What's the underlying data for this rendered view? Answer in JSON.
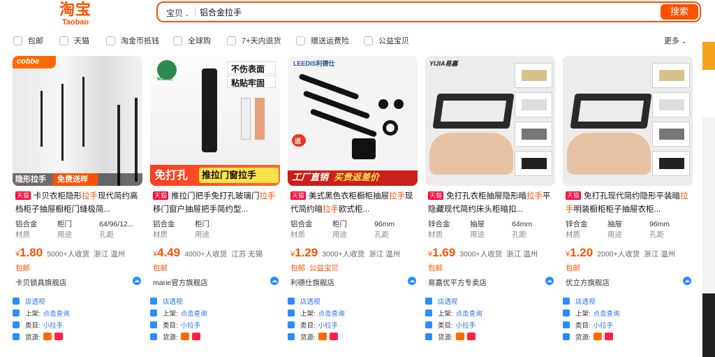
{
  "header": {
    "logo_cn": "淘宝",
    "logo_en": "Taobao",
    "scope": "宝贝",
    "query": "铝合金拉手",
    "search_button": "搜索"
  },
  "filters": {
    "items": [
      "包邮",
      "天猫",
      "淘金币抵钱",
      "全球购",
      "7+天内退货",
      "赠送运费险",
      "公益宝贝"
    ],
    "more": "更多"
  },
  "accent_color": "#ff5000",
  "products": [
    {
      "badge": "天猫",
      "title_pre": "卡贝衣柜隐形",
      "title_hl": "拉手",
      "title_post": "现代简约高档柜子抽屉橱柜门缝极简...",
      "attrs": [
        [
          "铝合金",
          "材质"
        ],
        [
          "柜门",
          "用途"
        ],
        [
          "64/96/12...",
          "孔距"
        ]
      ],
      "price": "1.80",
      "sold": "5000+人收货",
      "location": "浙江 温州",
      "tags": [
        "包邮"
      ],
      "shop": "卡贝锁具旗舰店",
      "img_brand": "cobbe",
      "img_tags": [
        "隐形拉手",
        "免费送样"
      ]
    },
    {
      "badge": "天猫",
      "title_pre": "推拉门把手免打孔玻璃门",
      "title_hl": "拉手",
      "title_post": "移门窗户抽屉把手简约型...",
      "attrs": [
        [
          "铝合金",
          "材质"
        ],
        [
          "柜门",
          "用途"
        ],
        [
          "",
          ""
        ]
      ],
      "price": "4.49",
      "sold": "4000+人收货",
      "location": "江苏 无锡",
      "tags": [
        "包邮"
      ],
      "shop": "marie官方旗舰店",
      "img_brand": "MARIE",
      "img_tags": [
        "不伤表面",
        "粘贴牢固",
        "免打孔",
        "推拉门窗拉手"
      ]
    },
    {
      "badge": "天猫",
      "title_pre": "美式黑色衣柜橱柜抽屉",
      "title_hl": "拉手",
      "title_mid": "现代简约暗",
      "title_hl2": "拉手",
      "title_post": "欧式柜...",
      "attrs": [
        [
          "铝合金",
          "材质"
        ],
        [
          "柜门",
          "用途"
        ],
        [
          "96mm",
          "孔距"
        ]
      ],
      "price": "1.29",
      "sold": "3000+人收货",
      "location": "浙江 温州",
      "tags": [
        "包邮",
        "公益宝贝"
      ],
      "shop": "利德仕旗舰店",
      "img_brand": "LEEDIS利德仕",
      "img_tags": [
        "送",
        "工厂直销",
        "买贵返差价"
      ]
    },
    {
      "badge": "天猫",
      "title_pre": "免打孔衣柜抽屉隐形暗",
      "title_hl": "拉手",
      "title_post": "平隐藏现代简约床头柜暗扣...",
      "attrs": [
        [
          "锌合金",
          "材质"
        ],
        [
          "抽屉",
          "用途"
        ],
        [
          "64mm",
          "孔距"
        ]
      ],
      "price": "1.69",
      "sold": "3000+人收货",
      "location": "浙江 温州",
      "tags": [
        "包邮"
      ],
      "shop": "易嘉优平方专卖店",
      "img_brand": "YIJIA易嘉",
      "img_tags": []
    },
    {
      "badge": "天猫",
      "title_pre": "免打孔现代简约隐形平装暗",
      "title_hl": "拉手",
      "title_post": "明装橱柜柜子抽屉衣柜...",
      "attrs": [
        [
          "锌合金",
          "材质"
        ],
        [
          "抽屉",
          "用途"
        ],
        [
          "96mm",
          "孔距"
        ]
      ],
      "price": "1.20",
      "sold": "2000+人收货",
      "location": "浙江 温州",
      "tags": [
        "包邮"
      ],
      "shop": "优立方旗舰店",
      "img_brand": "",
      "img_tags": []
    }
  ],
  "ext": {
    "shop_view": "店透视",
    "listed_label": "上架:",
    "listed_link": "点击查询",
    "category_label": "类目:",
    "category_value": "小拉手",
    "source_label": "货源:"
  }
}
